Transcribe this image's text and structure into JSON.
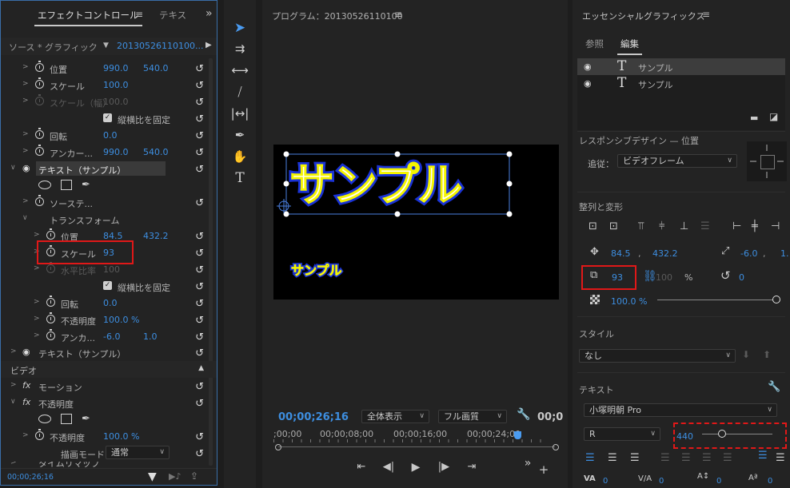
{
  "effect_controls": {
    "tab_label": "エフェクトコントロール",
    "tab_text": "テキス",
    "source_label": "ソース * グラフィック",
    "source_clip": "20130526110100...",
    "props": {
      "position": {
        "label": "位置",
        "x": "990.0",
        "y": "540.0"
      },
      "scale": {
        "label": "スケール",
        "value": "100.0"
      },
      "scale_w": {
        "label": "スケール（幅）",
        "value": "100.0"
      },
      "uniform": {
        "label": "縦横比を固定"
      },
      "rotation": {
        "label": "回転",
        "value": "0.0"
      },
      "anchor": {
        "label": "アンカー...",
        "x": "990.0",
        "y": "540.0"
      },
      "text_layer": {
        "label": "テキスト（サンプル）"
      },
      "source_text": {
        "label": "ソーステ..."
      },
      "transform": {
        "label": "トランスフォーム"
      },
      "t_position": {
        "label": "位置",
        "x": "84.5",
        "y": "432.2"
      },
      "t_scale": {
        "label": "スケール",
        "value": "93"
      },
      "t_hscale": {
        "label": "水平比率",
        "value": "100"
      },
      "t_uniform": {
        "label": "縦横比を固定"
      },
      "t_rotation": {
        "label": "回転",
        "value": "0.0"
      },
      "t_opacity": {
        "label": "不透明度",
        "value": "100.0 %"
      },
      "t_anchor": {
        "label": "アンカ...",
        "x": "-6.0",
        "y": "1.0"
      },
      "text_layer2": {
        "label": "テキスト（サンプル）"
      },
      "video_section": {
        "label": "ビデオ"
      },
      "motion": {
        "label": "モーション"
      },
      "opacity_fx": {
        "label": "不透明度"
      },
      "opacity": {
        "label": "不透明度",
        "value": "100.0 %"
      },
      "blend_mode": {
        "label": "描画モード",
        "value": "通常"
      },
      "time_remap": {
        "label": "タイムリマップ"
      }
    },
    "timecode": "00;00;26;16"
  },
  "program_monitor": {
    "title": "プログラム：20130526110100",
    "title_text": "サンプル",
    "small_text": "サンプル",
    "timecode": "00;00;26;16",
    "zoom": "全体表示",
    "quality": "フル画質",
    "end_time": "00;0",
    "ruler_labels": [
      ";00;00",
      "00;00;08;00",
      "00;00;16;00",
      "00;00;24;00"
    ]
  },
  "essential_graphics": {
    "title": "エッセンシャルグラフィックス",
    "tab_browse": "参照",
    "tab_edit": "編集",
    "layers": [
      "サンプル",
      "サンプル"
    ],
    "responsive_title": "レスポンシブデザイン — 位置",
    "follow_label": "追従：",
    "follow_value": "ビデオフレーム",
    "align_title": "整列と変形",
    "pos_x": "84.5",
    "pos_y": "432.2",
    "anchor_x": "-6.0",
    "anchor_y": "1.",
    "scale": "93",
    "scale_h": "100",
    "percent": "%",
    "rotation": "0",
    "opacity": "100.0 %",
    "style_title": "スタイル",
    "style_value": "なし",
    "text_title": "テキスト",
    "font": "小塚明朝 Pro",
    "font_style": "R",
    "font_size": "440",
    "bottom_values": [
      "0",
      "0",
      "0",
      "0"
    ]
  },
  "colors": {
    "accent": "#3d8ee0",
    "highlight_red": "#e01818"
  }
}
